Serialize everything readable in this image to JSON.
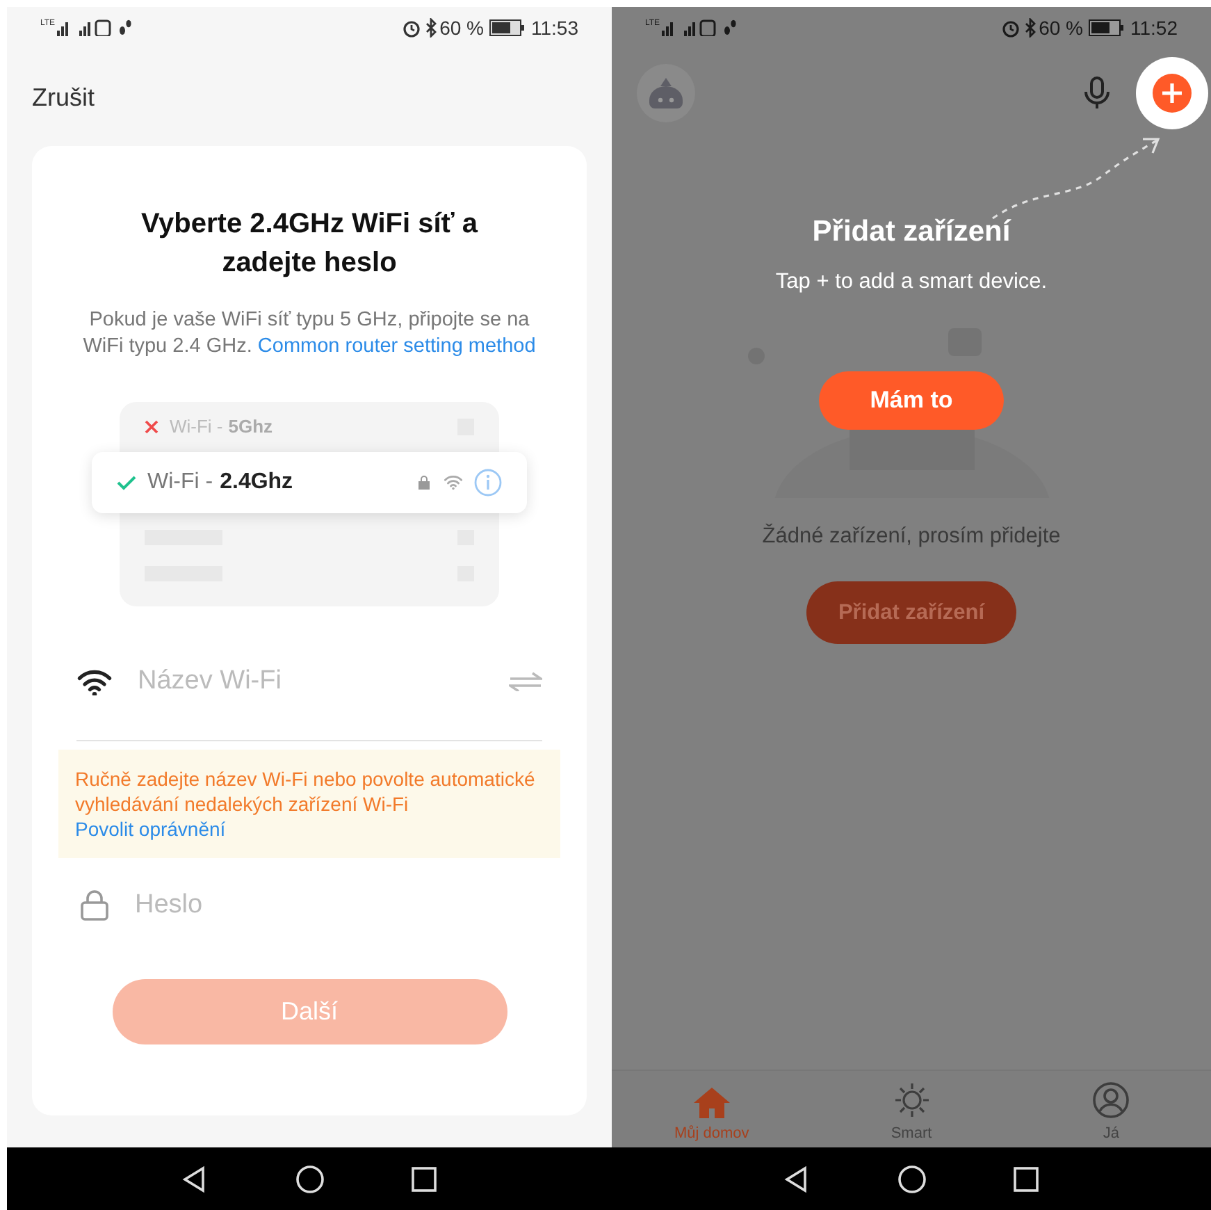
{
  "left_screen": {
    "status_bar": {
      "network": "LTE",
      "battery": "60 %",
      "time": "11:53"
    },
    "cancel": "Zrušit",
    "title": "Vyberte 2.4GHz WiFi síť a zadejte heslo",
    "description": {
      "text": "Pokud je vaše WiFi síť typu 5 GHz, připojte se na WiFi typu 2.4 GHz.",
      "link": "Common router setting method"
    },
    "networks": [
      {
        "prefix": "Wi-Fi -",
        "band": "5Ghz",
        "selected": false
      },
      {
        "prefix": "Wi-Fi -",
        "band": "2.4Ghz",
        "selected": true
      }
    ],
    "wifi_field": {
      "placeholder": "Název Wi-Fi"
    },
    "warning": {
      "text": "Ručně zadejte název Wi-Fi nebo povolte automatické vyhledávání nedalekých zařízení Wi-Fi",
      "link": "Povolit oprávnění"
    },
    "password_field": {
      "placeholder": "Heslo"
    },
    "next_button": {
      "label": "Další",
      "disabled": true
    }
  },
  "right_screen": {
    "status_bar": {
      "network": "LTE",
      "battery": "60 %",
      "time": "11:52"
    },
    "hint_title": "Přidat zařízení",
    "hint_text": "Tap + to add a smart device.",
    "got_it_button": "Mám to",
    "empty_text": "Žádné zařízení, prosím přidejte",
    "add_button": "Přidat zařízení",
    "tabs": [
      {
        "label": "Můj domov",
        "selected": true
      },
      {
        "label": "Smart",
        "selected": false
      },
      {
        "label": "Já",
        "selected": false
      }
    ]
  }
}
